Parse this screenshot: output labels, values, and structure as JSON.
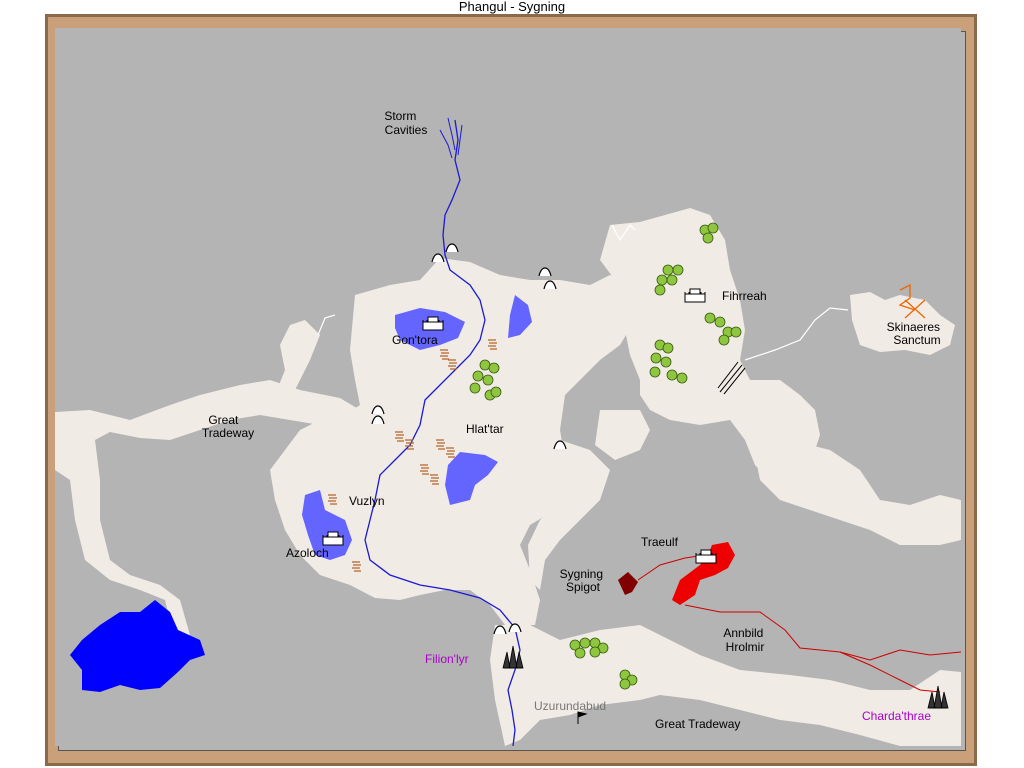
{
  "title": "Phangul - Sygning",
  "colors": {
    "sea": "#b4b4b4",
    "land": "#f1ebe6",
    "lake": "#6464ff",
    "deep_lake": "#0000ff",
    "river": "#1a1ad6",
    "forest": "#8ec63f",
    "red_region": "#ee0000",
    "dark_red": "#800000",
    "road_red": "#cc0000",
    "settlement_purple": "#aa00cc",
    "frame": "#c9a07a"
  },
  "labels": {
    "storm_line1": "Storm",
    "storm_line2": "Cavities",
    "great_tradeway_line1": "Great",
    "great_tradeway_line2": "Tradeway",
    "gontora": "Gon'tora",
    "hlattar": "Hlat'tar",
    "vuzlyn": "Vuzlyn",
    "azoloch": "Azoloch",
    "fihrreah": "Fihrreah",
    "skinaeres_line1": "Skinaeres",
    "skinaeres_line2": "Sanctum",
    "traeulf": "Traeulf",
    "sygning_line1": "Sygning",
    "sygning_line2": "Spigot",
    "annbild_line1": "Annbild",
    "annbild_line2": "Hrolmir",
    "filionlyr": "Filion'lyr",
    "uzurundabud": "Uzurundabud",
    "great_tradeway_south": "Great Tradeway",
    "chardathrae": "Charda'thrae"
  },
  "icons": {
    "castle": "castle-icon",
    "tower": "tower-icon",
    "forest": "tree-cluster-icon",
    "hills": "hills-icon",
    "farmland": "farmland-icon",
    "cave": "cave-entrance-icon",
    "flag": "flag-icon",
    "ruin": "ruin-sigil-icon",
    "bridge": "bridge-icon"
  }
}
